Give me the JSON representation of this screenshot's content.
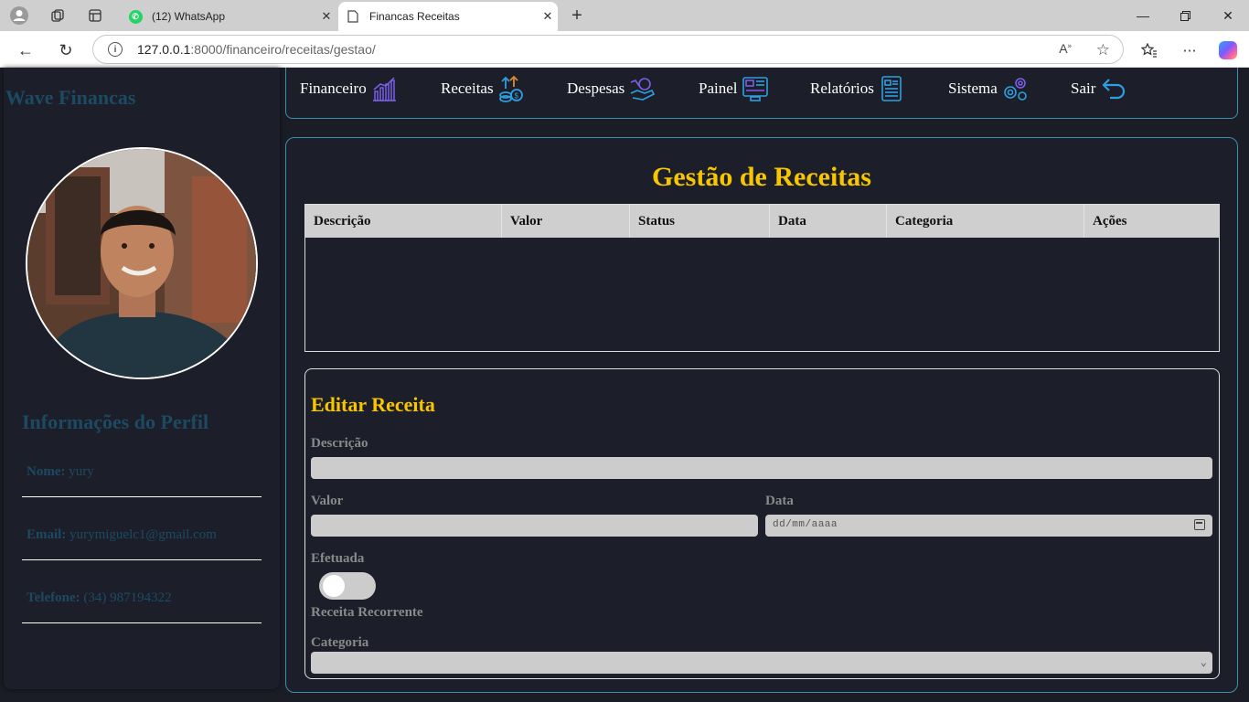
{
  "browser": {
    "tabs": [
      {
        "title": "(12) WhatsApp"
      },
      {
        "title": "Financas Receitas"
      }
    ],
    "url_host": "127.0.0.1",
    "url_rest": ":8000/financeiro/receitas/gestao/"
  },
  "sidebar": {
    "brand": "Wave Financas",
    "profile_title": "Informações do Perfil",
    "name_label": "Nome:",
    "name_value": "yury",
    "email_label": "Email:",
    "email_value": "yurymiguelc1@gmail.com",
    "phone_label": "Telefone:",
    "phone_value": "(34) 987194322"
  },
  "nav": {
    "items": [
      {
        "label": "Financeiro",
        "icon": "chart-icon"
      },
      {
        "label": "Receitas",
        "icon": "coins-up-icon"
      },
      {
        "label": "Despesas",
        "icon": "hand-coin-icon"
      },
      {
        "label": "Painel",
        "icon": "dashboard-icon"
      },
      {
        "label": "Relatórios",
        "icon": "report-icon"
      },
      {
        "label": "Sistema",
        "icon": "gears-icon"
      },
      {
        "label": "Sair",
        "icon": "return-icon"
      }
    ]
  },
  "main": {
    "title": "Gestão de Receitas",
    "columns": [
      "Descrição",
      "Valor",
      "Status",
      "Data",
      "Categoria",
      "Ações"
    ],
    "rows": []
  },
  "edit": {
    "title": "Editar Receita",
    "description_label": "Descrição",
    "value_label": "Valor",
    "date_label": "Data",
    "date_placeholder": "dd/mm/aaaa",
    "done_label": "Efetuada",
    "recurring_label": "Receita Recorrente",
    "category_label": "Categoria"
  },
  "colors": {
    "accent": "#f7c600",
    "muted_blue": "#1c4a63",
    "border": "#3b8fa8",
    "background": "#1c1f29"
  }
}
